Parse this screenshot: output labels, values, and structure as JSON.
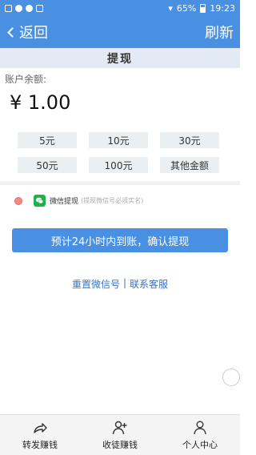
{
  "status_bar": {
    "battery": "65%",
    "time": "19:23"
  },
  "nav": {
    "back_label": "返回",
    "refresh_label": "刷新"
  },
  "page": {
    "title": "提现"
  },
  "balance": {
    "label": "账户余额:",
    "value": "¥ 1.00"
  },
  "amounts": [
    {
      "label": "5元"
    },
    {
      "label": "10元"
    },
    {
      "label": "30元"
    },
    {
      "label": "50元"
    },
    {
      "label": "100元"
    },
    {
      "label": "其他金额"
    }
  ],
  "payment": {
    "label": "微信提现",
    "hint": "(提现微信号必须实名)"
  },
  "confirm_label": "预计24小时内到账，确认提现",
  "links": {
    "reset_wechat": "重置微信号",
    "separator": "|",
    "contact": "联系客服"
  },
  "bottom_nav": [
    {
      "label": "转发赚钱",
      "icon": "share-icon"
    },
    {
      "label": "收徒赚钱",
      "icon": "add-user-icon"
    },
    {
      "label": "个人中心",
      "icon": "user-icon"
    }
  ],
  "colors": {
    "primary": "#4a90e2",
    "wechat": "#22b04a",
    "link": "#3a73c2"
  }
}
